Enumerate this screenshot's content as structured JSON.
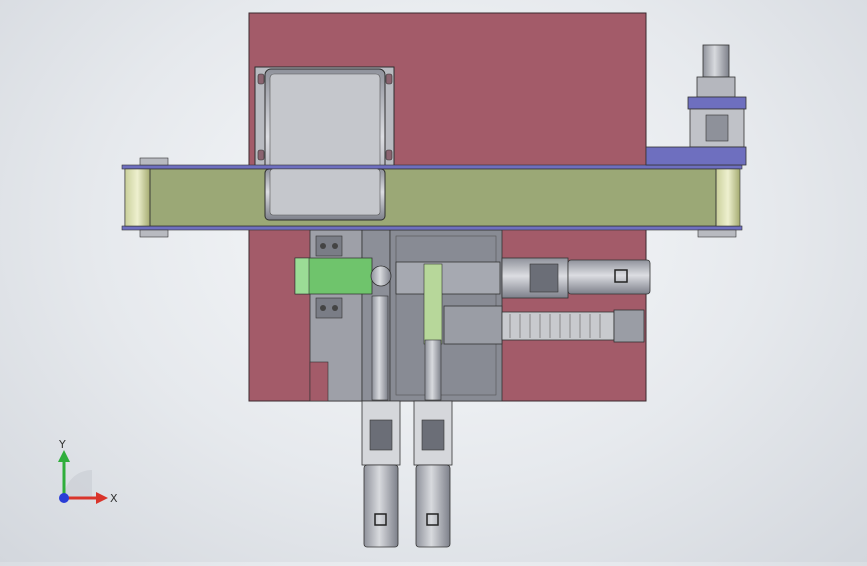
{
  "window": {
    "title": ""
  },
  "model": {
    "plate_color": "#a35b69",
    "conveyor_color": "#9ba876",
    "metal_color": "#a6a9b1",
    "accent_green": "#6fc46c",
    "accent_blue": "#6e6fbf"
  },
  "triad": {
    "x_label": "X",
    "y_label": "Y",
    "x_color": "#d9342b",
    "y_color": "#2fae3b",
    "z_color": "#2a3dd6"
  }
}
